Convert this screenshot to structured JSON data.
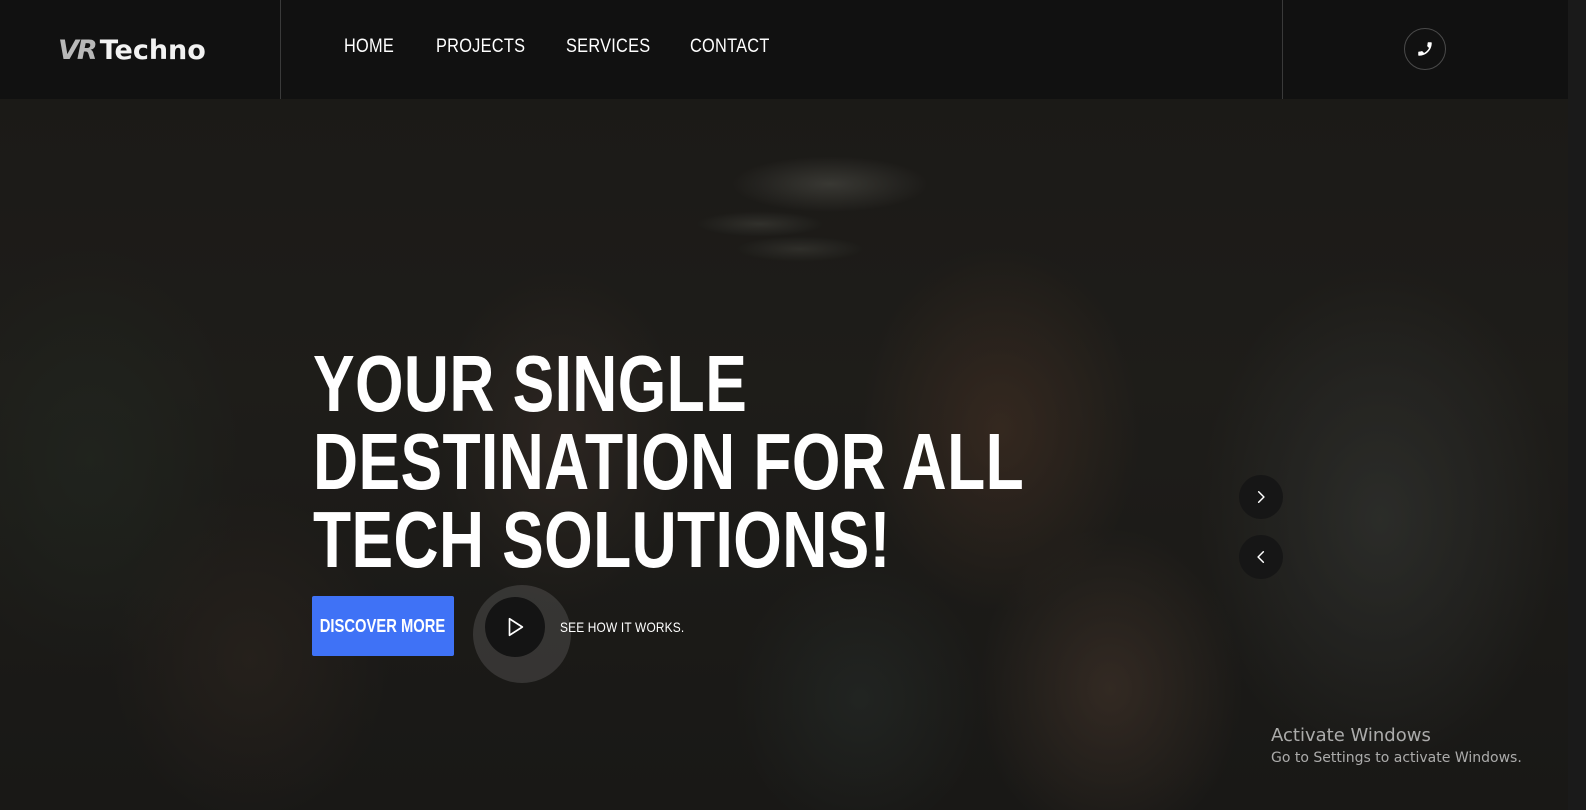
{
  "header": {
    "logo_mark": "VR",
    "logo_text": "Techno",
    "nav": [
      "HOME",
      "PROJECTS",
      "SERVICES",
      "CONTACT"
    ],
    "phone_icon": "phone-icon"
  },
  "hero": {
    "headline_lines": [
      "YOUR SINGLE",
      "DESTINATION FOR ALL",
      "TECH SOLUTIONS!"
    ],
    "primary_button": "DISCOVER MORE",
    "video_label": "SEE HOW IT WORKS.",
    "play_icon": "play-icon",
    "next_icon": "chevron-right-icon",
    "prev_icon": "chevron-left-icon"
  },
  "overlay": {
    "activate_title": "Activate Windows",
    "activate_subtitle": "Go to Settings to activate Windows."
  },
  "colors": {
    "header_bg": "#111111",
    "accent": "#3f72f6",
    "text": "#ffffff"
  }
}
